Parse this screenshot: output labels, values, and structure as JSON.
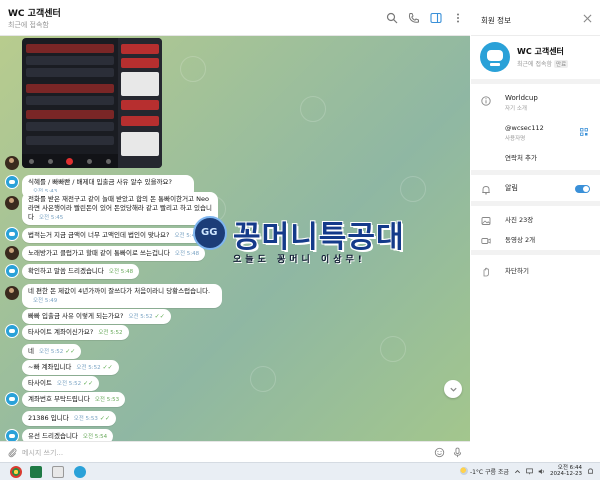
{
  "chat": {
    "title": "WC 고객센터",
    "subtitle": "최근에 접속함",
    "composer_placeholder": "메시지 쓰기...",
    "messages": [
      {
        "text": "식혜를 / 빠빠빤 / 배제대 입출금 사유 알수 있을까요?",
        "time": "오전 5:43",
        "direction": "in"
      },
      {
        "text": "전화를 받은 재전구고 같이 놀때 받았고 합의 돈 통빠이한거고 Neo라면 사은행이라 빨린돈이 있어 돈었당해라 같고 빨리고 하고 있습니다",
        "time": "오전 5:45",
        "direction": "in"
      },
      {
        "text": "법적는거 지금 금액이 너무 고액인데 법인이 맞나요?",
        "time": "오전 5:45",
        "direction": "in"
      },
      {
        "text": "노래방가고 클럽가고 할때 같이 통빠이로 쓰는겁니다",
        "time": "오전 5:48",
        "direction": "in"
      },
      {
        "text": "확인하고 말씀 드리겠습니다",
        "time": "오전 5:48",
        "direction": "out"
      },
      {
        "text": "네 편한 돈 제값이 4년가까이 잘쓰다가 처음이라니 당황스럽습니다.",
        "time": "오전 5:49",
        "direction": "in"
      },
      {
        "text": "빠빠 입출금 사유 이렇게 되는가요?",
        "time": "오전 5:52",
        "direction": "in"
      },
      {
        "text": "타사이트 계좌이신가요?",
        "time": "오전 5:52",
        "direction": "out"
      },
      {
        "text": "네",
        "time": "오전 5:52",
        "direction": "in"
      },
      {
        "text": "~빠 계좌입니다",
        "time": "오전 5:52",
        "direction": "in"
      },
      {
        "text": "타사이트",
        "time": "오전 5:52",
        "direction": "in"
      },
      {
        "text": "계좌번호 부탁드립니다",
        "time": "오전 5:53",
        "direction": "out"
      },
      {
        "text": "21386 입니다",
        "time": "오전 5:53",
        "direction": "in"
      },
      {
        "text": "유선 드리겠습니다",
        "time": "오전 5:54",
        "direction": "out"
      }
    ]
  },
  "watermark": {
    "title": "꽁머니특공대",
    "subtitle": "오늘도 꽁머니 이상무!"
  },
  "info": {
    "title": "회원 정보",
    "name": "WC 고객센터",
    "status": "최근에 접속함",
    "status_badge": "만료",
    "bio": "Worldcup",
    "bio_label": "자기 소개",
    "username": "@wcsec112",
    "username_label": "사용자명",
    "add_contact": "연락처 추가",
    "notifications": "알림",
    "photos": "사진 23장",
    "videos": "동영상 2개",
    "block": "차단하기"
  },
  "taskbar": {
    "weather": "-1°C 구름 조금",
    "time": "오전 6:44",
    "date": "2024-12-23"
  },
  "colors": {
    "accent": "#3a90d8",
    "chat_bg": "#a3c68d",
    "danger": "#e25353"
  }
}
